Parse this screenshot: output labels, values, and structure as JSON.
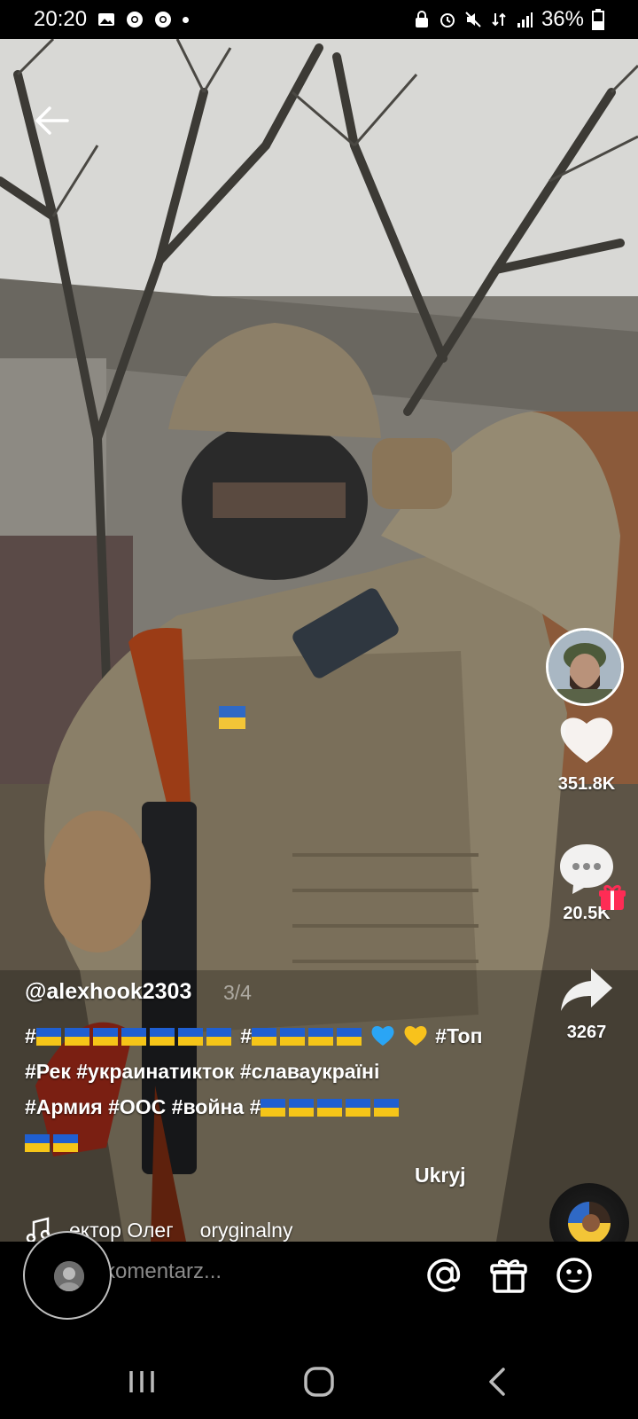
{
  "status_bar": {
    "time": "20:20",
    "battery": "36%",
    "left_icons": [
      "gallery-icon",
      "chrome-icon",
      "chrome-icon",
      "dot-icon"
    ],
    "right_icons": [
      "lock-icon",
      "alarm-icon",
      "mute-icon",
      "data-icon",
      "signal-icon",
      "battery-icon"
    ]
  },
  "video": {
    "username": "@alexhook2303",
    "page_indicator": "3/4",
    "caption_lines": [
      {
        "text_parts": [
          "#",
          "FLAGS7",
          " #",
          "FLAGS4",
          "HEARTS",
          " #Топ"
        ]
      },
      {
        "text": "#Рек #украинатикток #славаукраїні"
      },
      {
        "text": "#Армия #ООС #война #"
      },
      {
        "text": ""
      }
    ],
    "line3_tail": "#Армия #ООС #война #",
    "caption_line2": "#Рек #украинатикток #славаукраїні",
    "caption_line1_tail": " #Топ",
    "hide_label": "Ukryj",
    "music_author": "ектор Олег",
    "music_title": "oryginalny",
    "progress": 0.75
  },
  "right_rail": {
    "like_count": "351.8K",
    "comment_count": "20.5K",
    "share_count": "3267"
  },
  "comment_bar": {
    "placeholder": "komentarz..."
  },
  "colors": {
    "flag_blue": "#1f5fd1",
    "flag_yellow": "#f5c518",
    "heart_blue": "#2aa5f5",
    "heart_yellow": "#f8c21c",
    "gift_red": "#fe2c55"
  }
}
